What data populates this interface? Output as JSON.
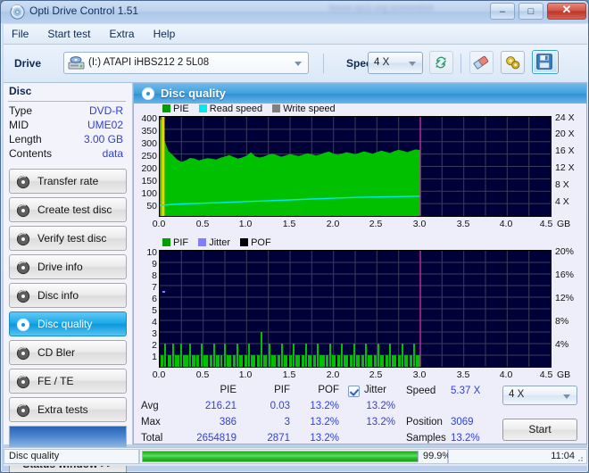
{
  "window": {
    "title": "Opti Drive Control 1.51",
    "icon": "disc-icon",
    "watermark": "forum.rpc1.org screenshot",
    "buttons": {
      "minimize": "–",
      "maximize": "□",
      "close": "✕"
    }
  },
  "menu": {
    "items": [
      "File",
      "Start test",
      "Extra",
      "Help"
    ]
  },
  "toolbar": {
    "drive_label": "Drive",
    "drive_value": "(I:)  ATAPI iHBS212  2 5L08",
    "speed_label": "Speed",
    "speed_value": "4 X",
    "buttons": [
      {
        "name": "refresh-drive-button",
        "icon": "refresh-icon"
      },
      {
        "name": "eraser-button",
        "icon": "eraser-icon"
      },
      {
        "name": "settings-button",
        "icon": "gears-icon"
      },
      {
        "name": "save-button",
        "icon": "floppy-save-icon"
      }
    ]
  },
  "sidebar": {
    "disc_header": "Disc",
    "disc_rows": [
      {
        "key": "Type",
        "value": "DVD-R"
      },
      {
        "key": "MID",
        "value": "UME02"
      },
      {
        "key": "Length",
        "value": "3.00 GB"
      },
      {
        "key": "Contents",
        "value": "data"
      }
    ],
    "items": [
      {
        "label": "Transfer rate",
        "icon": "disc-icon",
        "active": false
      },
      {
        "label": "Create test disc",
        "icon": "disc-icon",
        "active": false
      },
      {
        "label": "Verify test disc",
        "icon": "disc-icon",
        "active": false
      },
      {
        "label": "Drive info",
        "icon": "disc-icon",
        "active": false
      },
      {
        "label": "Disc info",
        "icon": "disc-icon",
        "active": false
      },
      {
        "label": "Disc quality",
        "icon": "disc-icon",
        "active": true
      },
      {
        "label": "CD Bler",
        "icon": "disc-icon",
        "active": false
      },
      {
        "label": "FE / TE",
        "icon": "disc-icon",
        "active": false
      },
      {
        "label": "Extra tests",
        "icon": "disc-icon",
        "active": false
      }
    ],
    "status_window_button": "Status window >>"
  },
  "panel": {
    "title": "Disc quality",
    "icon": "disc-quality-icon"
  },
  "stats": {
    "col_headers": [
      "PIE",
      "PIF",
      "POF",
      "Jitter"
    ],
    "jitter_checked": true,
    "rows": [
      {
        "label": "Avg",
        "pie": "216.21",
        "pif": "0.03",
        "pof": "13.2%",
        "jitter": "13.2%"
      },
      {
        "label": "Max",
        "pie": "386",
        "pif": "3",
        "pof": "13.2%",
        "jitter": "13.2%"
      },
      {
        "label": "Total",
        "pie": "2654819",
        "pif": "2871",
        "pof": "13.2%",
        "jitter": ""
      }
    ],
    "right": [
      {
        "label": "Speed",
        "value": "5.37 X"
      },
      {
        "label": "Position",
        "value": "3069"
      },
      {
        "label": "Samples",
        "value": "13.2%"
      }
    ],
    "speed_select": "4 X",
    "start_button": "Start"
  },
  "statusbar": {
    "task": "Disc quality",
    "progress_label": "99.9%",
    "progress_percent": 99.9,
    "elapsed": "11:04"
  },
  "colors": {
    "pie_green": "#00c000",
    "read_speed_cyan": "#00e8f0",
    "write_speed_gray": "#808080",
    "pif_green": "#00c000",
    "jitter_lavender": "#8080ff",
    "pof_black": "#000000",
    "plot_bg": "#000038",
    "grid": "#4a4a5c",
    "marker_magenta": "#c030a0",
    "accent_blue": "#3f9ede",
    "value_blue": "#2f3fd8"
  },
  "chart_data": [
    {
      "type": "area",
      "name": "pie-chart",
      "title": "",
      "xlabel": "GB",
      "ylabel": "PIE",
      "y2label": "X",
      "xlim": [
        0,
        4.5
      ],
      "ylim": [
        0,
        400
      ],
      "y2lim": [
        0,
        24
      ],
      "grid": true,
      "legend_position": "top-left",
      "legend": [
        "PIE",
        "Read speed",
        "Write speed"
      ],
      "xticks": [
        "0.0",
        "0.5",
        "1.0",
        "1.5",
        "2.0",
        "2.5",
        "3.0",
        "3.5",
        "4.0",
        "4.5"
      ],
      "yticks": [
        "400",
        "350",
        "300",
        "250",
        "200",
        "150",
        "100",
        "50"
      ],
      "y2ticks": [
        "24 X",
        "20 X",
        "16 X",
        "12 X",
        "8 X",
        "4 X"
      ],
      "data_end_x": 3.0,
      "marker_x": 3.0,
      "series": [
        {
          "name": "PIE",
          "color": "#00c000",
          "x": [
            0.0,
            0.02,
            0.04,
            0.06,
            0.08,
            0.1,
            0.15,
            0.2,
            0.25,
            0.3,
            0.35,
            0.4,
            0.45,
            0.5,
            0.55,
            0.6,
            0.65,
            0.7,
            0.75,
            0.8,
            0.85,
            0.9,
            0.95,
            1.0,
            1.05,
            1.1,
            1.15,
            1.2,
            1.25,
            1.3,
            1.35,
            1.4,
            1.45,
            1.5,
            1.55,
            1.6,
            1.65,
            1.7,
            1.75,
            1.8,
            1.85,
            1.9,
            1.95,
            2.0,
            2.05,
            2.1,
            2.15,
            2.2,
            2.25,
            2.3,
            2.35,
            2.4,
            2.45,
            2.5,
            2.55,
            2.6,
            2.65,
            2.7,
            2.75,
            2.8,
            2.85,
            2.9,
            2.95,
            3.0
          ],
          "values": [
            400,
            380,
            330,
            300,
            280,
            262,
            246,
            228,
            222,
            226,
            232,
            230,
            226,
            229,
            233,
            231,
            228,
            235,
            240,
            246,
            238,
            232,
            236,
            243,
            247,
            241,
            236,
            240,
            247,
            251,
            245,
            239,
            244,
            250,
            246,
            242,
            247,
            253,
            249,
            244,
            248,
            256,
            260,
            252,
            247,
            252,
            258,
            254,
            249,
            255,
            261,
            256,
            250,
            255,
            262,
            258,
            253,
            259,
            264,
            259,
            254,
            260,
            265,
            262
          ]
        },
        {
          "name": "Read speed",
          "color": "#00e8f0",
          "x": [
            0.0,
            0.25,
            0.5,
            0.75,
            1.0,
            1.25,
            1.5,
            1.75,
            2.0,
            2.25,
            2.5,
            2.75,
            3.0
          ],
          "values": [
            2.6,
            2.9,
            3.1,
            3.3,
            3.5,
            3.7,
            3.9,
            4.1,
            4.3,
            4.5,
            4.6,
            4.7,
            4.8
          ]
        },
        {
          "name": "Write speed",
          "color": "#808080",
          "x": [],
          "values": []
        }
      ]
    },
    {
      "type": "bar",
      "name": "pif-chart",
      "title": "",
      "xlabel": "GB",
      "ylabel": "PIF",
      "y2label": "%",
      "xlim": [
        0,
        4.5
      ],
      "ylim": [
        0,
        10
      ],
      "y2lim": [
        0,
        20
      ],
      "grid": true,
      "legend_position": "top-left",
      "legend": [
        "PIF",
        "Jitter",
        "POF"
      ],
      "xticks": [
        "0.0",
        "0.5",
        "1.0",
        "1.5",
        "2.0",
        "2.5",
        "3.0",
        "3.5",
        "4.0",
        "4.5"
      ],
      "yticks": [
        "10",
        "9",
        "8",
        "7",
        "6",
        "5",
        "4",
        "3",
        "2",
        "1"
      ],
      "y2ticks": [
        "20%",
        "16%",
        "12%",
        "8%",
        "4%"
      ],
      "data_end_x": 3.0,
      "marker_x": 3.0,
      "series": [
        {
          "name": "PIF",
          "color": "#00c000",
          "note": "dense 1-2 max spikes across 0..3.0 GB, single spike of 3 near 0.47",
          "max": 3,
          "typical": 1
        },
        {
          "name": "Jitter",
          "color": "#8080ff",
          "note": "faint trace near 6.5 at x=0.03"
        },
        {
          "name": "POF",
          "color": "#000000",
          "values": []
        }
      ]
    }
  ]
}
